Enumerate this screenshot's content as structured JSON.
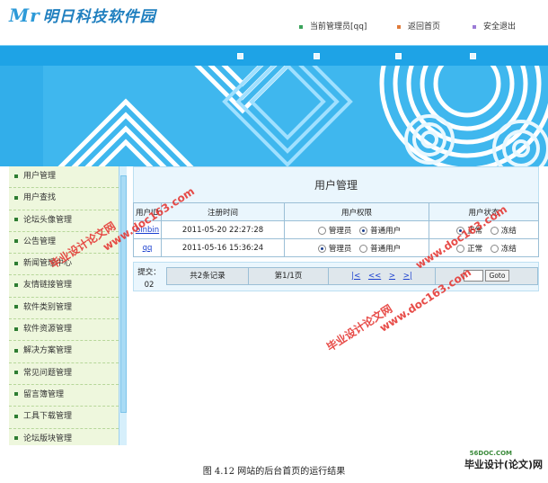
{
  "header": {
    "logo_mark": "Mr",
    "logo_text": "明日科技软件园",
    "nav": [
      {
        "label": "当前管理员[qq]",
        "color": "#3aa35b"
      },
      {
        "label": "返回首页",
        "color": "#e07b3a"
      },
      {
        "label": "安全退出",
        "color": "#9b7bd6"
      }
    ]
  },
  "sidebar": {
    "items": [
      "用户管理",
      "用户查找",
      "论坛头像管理",
      "公告管理",
      "新闻管理中心",
      "友情链接管理",
      "软件类别管理",
      "软件资源管理",
      "解决方案管理",
      "常见问题管理",
      "留言簿管理",
      "工具下载管理",
      "论坛版块管理"
    ]
  },
  "main": {
    "title": "用户管理",
    "columns": [
      "用户ID",
      "注册时间",
      "用户权限",
      "用户状态"
    ],
    "rows": [
      {
        "id": "binbin",
        "reg_time": "2011-05-20 22:27:28",
        "perm_admin": "管理员",
        "perm_user": "普通用户",
        "perm_selected": "user",
        "state_normal": "正常",
        "state_frozen": "冻结",
        "state_selected": "normal"
      },
      {
        "id": "qq",
        "reg_time": "2011-05-16 15:36:24",
        "perm_admin": "管理员",
        "perm_user": "普通用户",
        "perm_selected": "admin",
        "state_normal": "正常",
        "state_frozen": "冻结",
        "state_selected": "none"
      }
    ],
    "submit_label": "提交：",
    "submit_code": "02",
    "pager": {
      "records": "共2条记录",
      "page": "第1/1页",
      "first": "|<",
      "prev": "<<",
      "next": ">",
      "last": ">|",
      "goto_label": "Goto"
    }
  },
  "watermarks": [
    "毕业设计论文网",
    "www.doc163.com"
  ],
  "caption": "图 4.12  网站的后台首页的运行结果",
  "brand": {
    "site": "56DOC.COM",
    "name": "毕业设计(论文)网"
  }
}
